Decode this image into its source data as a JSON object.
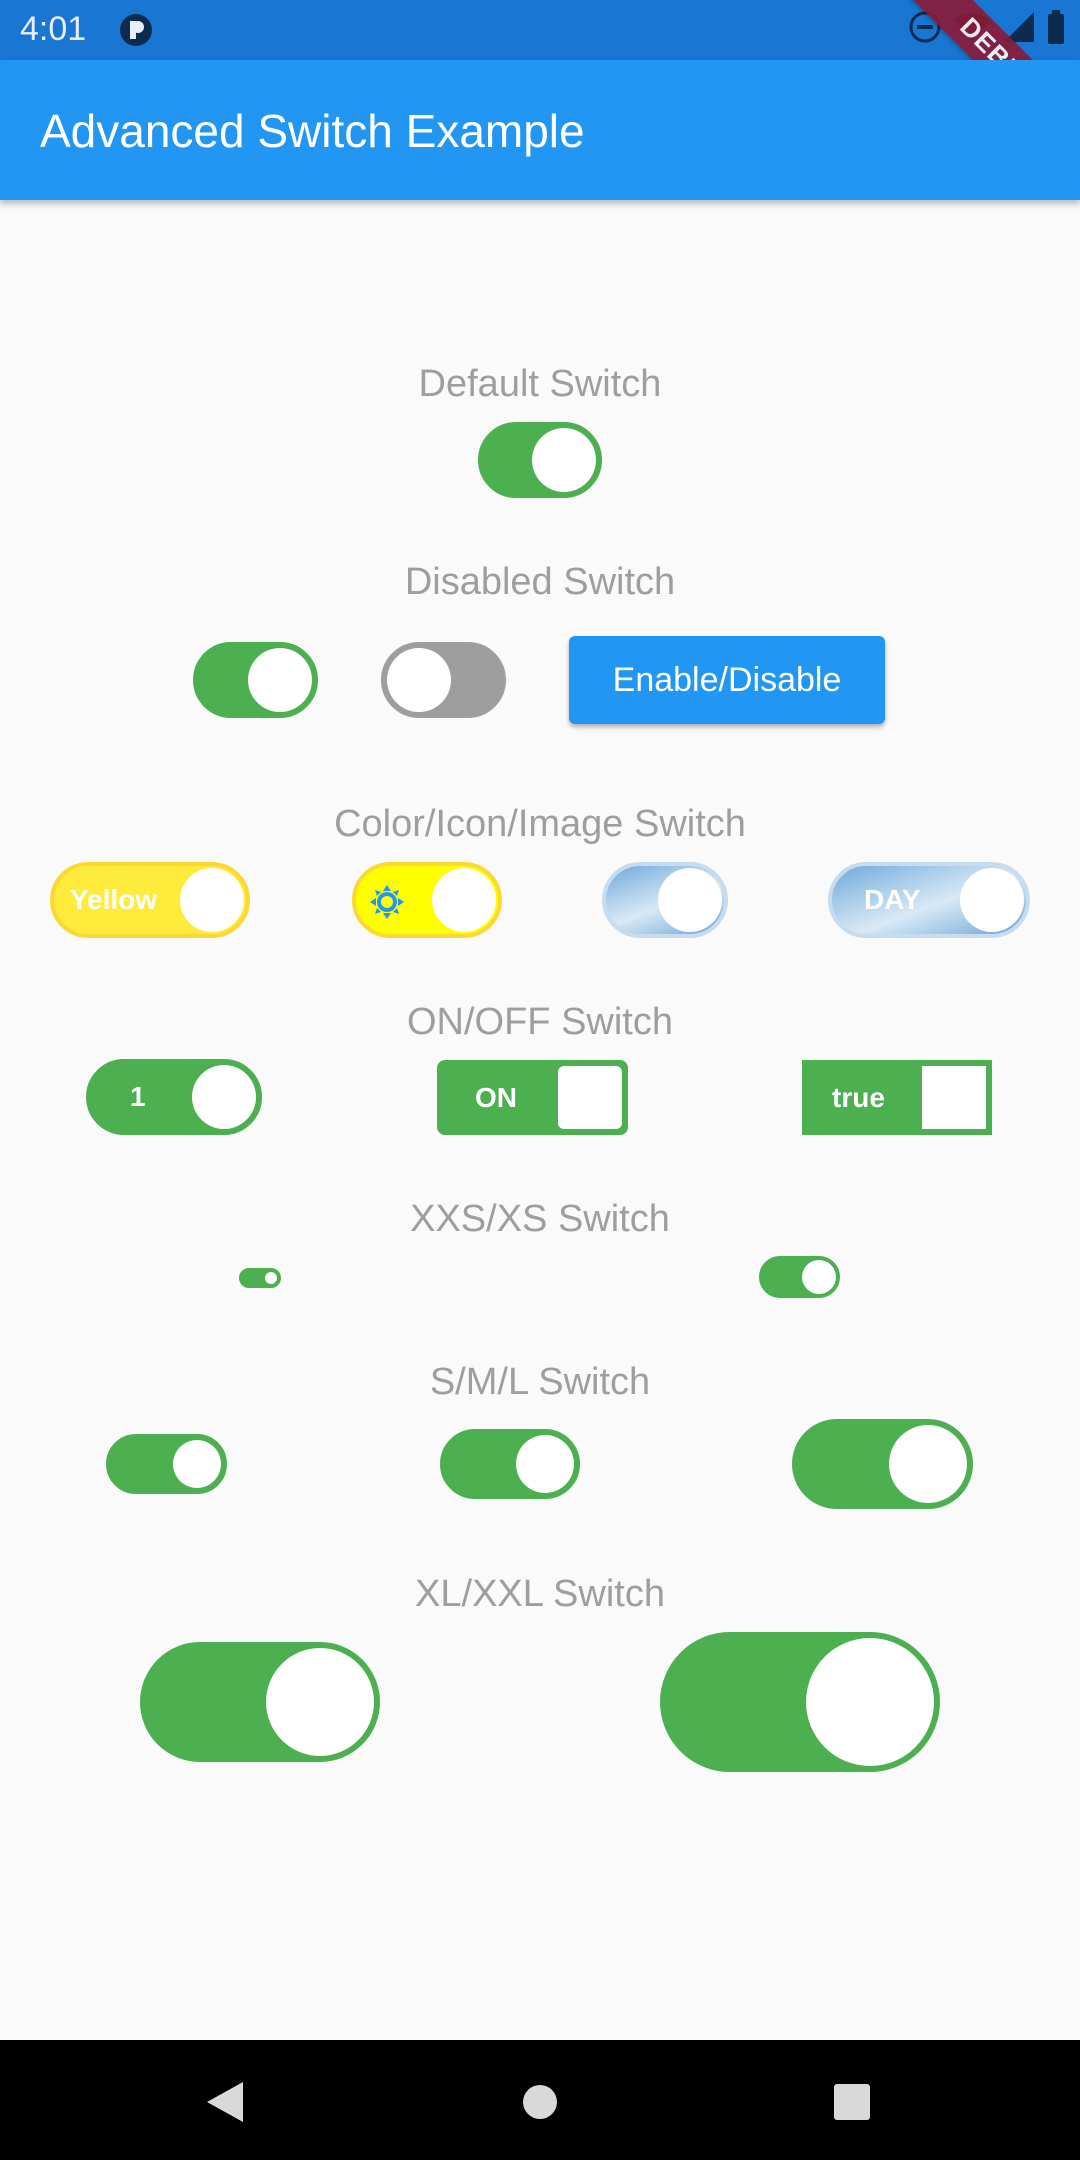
{
  "status": {
    "time": "4:01",
    "debug": "DEBUG"
  },
  "app_bar": {
    "title": "Advanced Switch Example"
  },
  "sections": {
    "default": "Default Switch",
    "disabled": "Disabled Switch",
    "color": "Color/Icon/Image Switch",
    "onoff": "ON/OFF Switch",
    "xxs_xs": "XXS/XS Switch",
    "sml": "S/M/L Switch",
    "xl_xxl": "XL/XXL Switch"
  },
  "buttons": {
    "enable_disable": "Enable/Disable"
  },
  "switch_labels": {
    "yellow": "Yellow",
    "day": "DAY",
    "one": "1",
    "on": "ON",
    "true": "true"
  },
  "colors": {
    "active": "#4caf50",
    "inactive": "#9e9e9e",
    "yellow": "#ffeb3b",
    "accent": "#2196f3",
    "status_bar": "#1976d2"
  },
  "switch_states": {
    "default": true,
    "disabled_on": true,
    "disabled_off": false,
    "yellow": true,
    "icon": true,
    "image": true,
    "image_day": true,
    "on_one": true,
    "on_on": true,
    "on_true": true,
    "xxs": true,
    "xs": true,
    "s": true,
    "m": true,
    "l": true,
    "xl": true,
    "xxl": true
  },
  "icons": {
    "sun": "brightness-icon",
    "back": "back-icon",
    "home": "home-icon",
    "recents": "recents-icon"
  }
}
